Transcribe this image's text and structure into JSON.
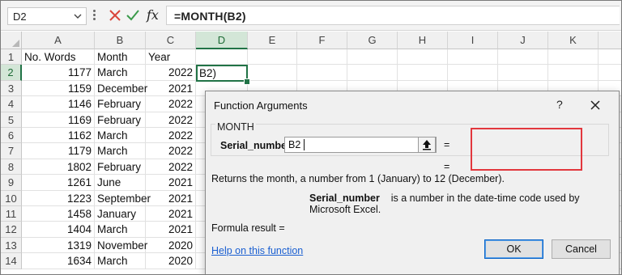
{
  "formula_bar": {
    "name_box": "D2",
    "fx_symbol": "fx",
    "formula": "=MONTH(B2)"
  },
  "columns": [
    "A",
    "B",
    "C",
    "D",
    "E",
    "F",
    "G",
    "H",
    "I",
    "J",
    "K"
  ],
  "rows": [
    {
      "num": "1",
      "a": "No. Words",
      "b": "Month",
      "c": "Year"
    },
    {
      "num": "2",
      "a": "1177",
      "b": "March",
      "c": "2022"
    },
    {
      "num": "3",
      "a": "1159",
      "b": "December",
      "c": "2021"
    },
    {
      "num": "4",
      "a": "1146",
      "b": "February",
      "c": "2022"
    },
    {
      "num": "5",
      "a": "1169",
      "b": "February",
      "c": "2022"
    },
    {
      "num": "6",
      "a": "1162",
      "b": "March",
      "c": "2022"
    },
    {
      "num": "7",
      "a": "1179",
      "b": "March",
      "c": "2022"
    },
    {
      "num": "8",
      "a": "1802",
      "b": "February",
      "c": "2022"
    },
    {
      "num": "9",
      "a": "1261",
      "b": "June",
      "c": "2021"
    },
    {
      "num": "10",
      "a": "1223",
      "b": "September",
      "c": "2021"
    },
    {
      "num": "11",
      "a": "1458",
      "b": "January",
      "c": "2021"
    },
    {
      "num": "12",
      "a": "1404",
      "b": "March",
      "c": "2021"
    },
    {
      "num": "13",
      "a": "1319",
      "b": "November",
      "c": "2020"
    },
    {
      "num": "14",
      "a": "1634",
      "b": "March",
      "c": "2020"
    }
  ],
  "active_cell_text": "B2)",
  "dialog": {
    "title": "Function Arguments",
    "help": "?",
    "function_name": "MONTH",
    "arg_label": "Serial_number",
    "arg_value": "B2",
    "eq_symbol": "=",
    "description": "Returns the month, a number from 1 (January) to 12 (December).",
    "arg_name": "Serial_number",
    "arg_description": "is a number in the date-time code used by Microsoft Excel.",
    "formula_result": "Formula result =",
    "help_link": "Help on this function",
    "ok_label": "OK",
    "cancel_label": "Cancel"
  },
  "colors": {
    "excel_green": "#217346",
    "highlight_red": "#e2373d",
    "cancel_x": "#d9453b",
    "enter_check": "#3a9a4a",
    "link_blue": "#1a5fd1"
  }
}
